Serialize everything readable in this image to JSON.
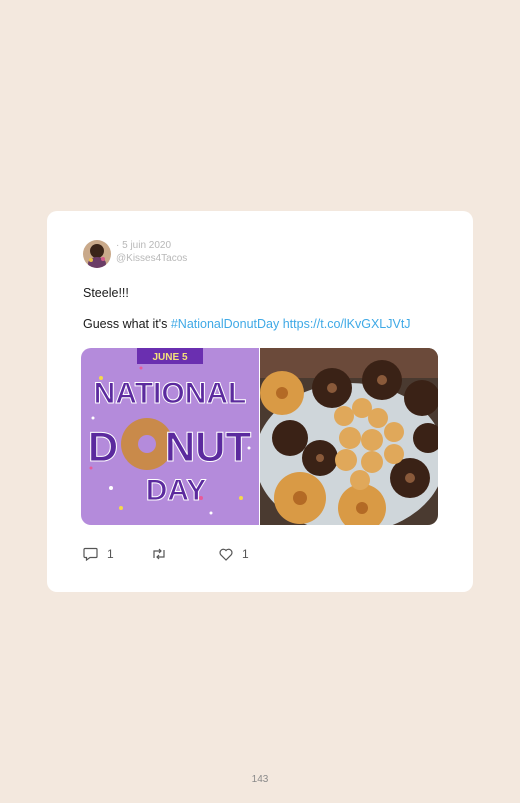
{
  "tweet": {
    "date": "· 5 juin 2020",
    "handle": "@Kisses4Tacos",
    "line1": "Steele!!!",
    "line2_prefix": "Guess what it's ",
    "hashtag": "#NationalDonutDay",
    "url": "https://t.co/lKvGXLJVtJ",
    "image_left": {
      "banner": "JUNE 5",
      "title_line1": "NATIONAL",
      "title_line2_a": "D",
      "title_line2_b": "NUT",
      "title_line3": "DAY"
    },
    "image_right": {
      "description": "donuts photo"
    },
    "actions": {
      "reply_count": "1",
      "like_count": "1"
    }
  },
  "page": {
    "number": "143"
  },
  "colors": {
    "background": "#f3e8de",
    "link": "#3fa9e6",
    "purple": "#a77fd4"
  }
}
